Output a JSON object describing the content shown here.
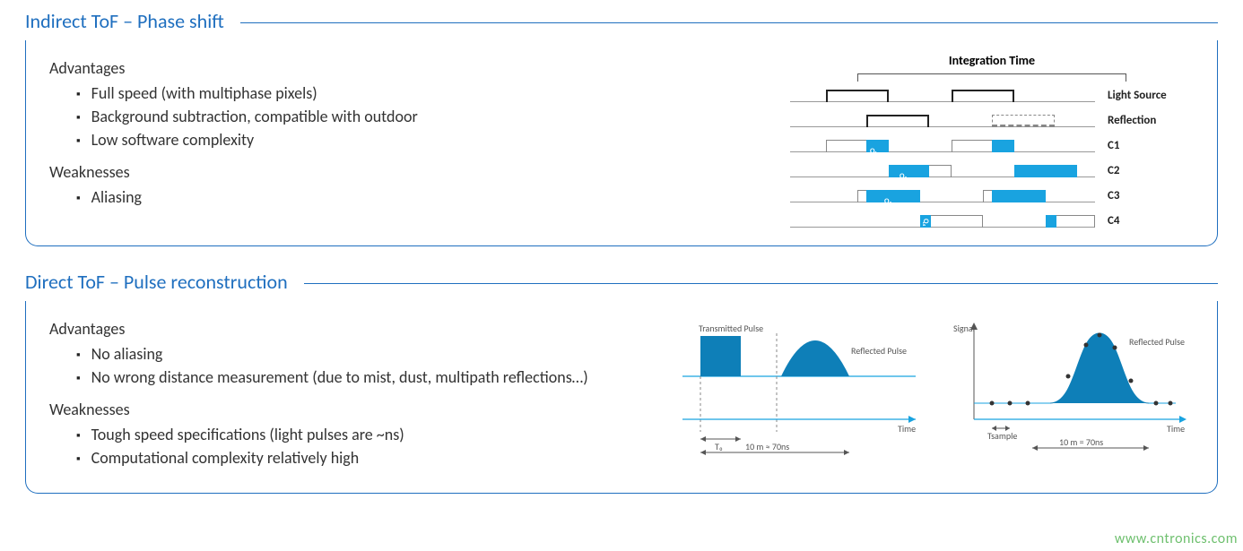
{
  "sections": [
    {
      "title": "Indirect ToF – Phase shift",
      "advantages_head": "Advantages",
      "advantages": [
        "Full speed (with multiphase pixels)",
        "Background subtraction, compatible with outdoor",
        "Low software complexity"
      ],
      "weaknesses_head": "Weaknesses",
      "weaknesses": [
        "Aliasing"
      ],
      "figure": {
        "integration_time": "Integration Time",
        "rows": [
          "Light Source",
          "Reflection",
          "C1",
          "C2",
          "C3",
          "C4"
        ],
        "q_labels": [
          "Q₁",
          "Q₂",
          "Q₃",
          "Q₄"
        ]
      }
    },
    {
      "title": "Direct ToF – Pulse reconstruction",
      "advantages_head": "Advantages",
      "advantages": [
        "No aliasing",
        "No wrong distance measurement  (due to mist, dust, multipath reflections…)"
      ],
      "weaknesses_head": "Weaknesses",
      "weaknesses": [
        "Tough speed specifications (light pulses are ~ns)",
        "Computational complexity relatively high"
      ],
      "figure": {
        "left": {
          "tx_label": "Transmitted Pulse",
          "rx_label": "Reflected Pulse",
          "t_axis": "Time",
          "t_marker_a": "T₀",
          "span": "10 m ≈ 70ns"
        },
        "right": {
          "y_label": "Signal",
          "rx_label": "Reflected Pulse",
          "t_axis": "Time",
          "sample": "Tsample",
          "span": "10 m = 70ns"
        }
      }
    }
  ],
  "watermark": "www.cntronics.com"
}
